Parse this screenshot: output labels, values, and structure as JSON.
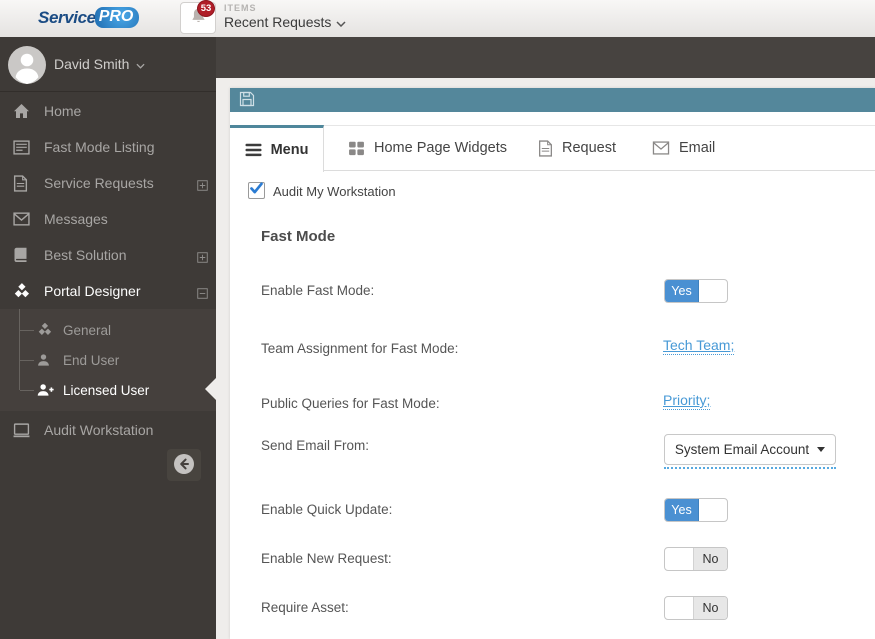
{
  "topbar": {
    "logo": {
      "brand_service": "Service",
      "brand_pro": "PRO"
    },
    "notification_badge": "53",
    "items_label": "ITEMS",
    "recent_dropdown": "Recent Requests"
  },
  "sidebar": {
    "user_name": "David Smith",
    "items": [
      {
        "label": "Home"
      },
      {
        "label": "Fast Mode Listing"
      },
      {
        "label": "Service Requests",
        "expandable": "collapsed"
      },
      {
        "label": "Messages"
      },
      {
        "label": "Best Solution",
        "expandable": "collapsed"
      },
      {
        "label": "Portal Designer",
        "expandable": "expanded",
        "active": true
      }
    ],
    "portal_designer_children": [
      {
        "label": "General"
      },
      {
        "label": "End User"
      },
      {
        "label": "Licensed User",
        "active": true
      }
    ],
    "audit_item": {
      "label": "Audit Workstation"
    }
  },
  "panel": {
    "tabs": [
      {
        "label": "Menu",
        "active": true
      },
      {
        "label": "Home Page Widgets"
      },
      {
        "label": "Request"
      },
      {
        "label": "Email"
      }
    ],
    "audit_checkbox_label": "Audit My Workstation",
    "audit_checkbox_checked": true,
    "section_title": "Fast Mode",
    "settings": [
      {
        "label": "Enable Fast Mode:",
        "type": "toggle",
        "value": "Yes"
      },
      {
        "label": "Team Assignment for Fast Mode:",
        "type": "link",
        "value": "Tech Team;"
      },
      {
        "label": "Public Queries for Fast Mode:",
        "type": "link",
        "value": "Priority;"
      },
      {
        "label": "Send Email From:",
        "type": "dropdown",
        "value": "System Email Account"
      },
      {
        "label": "Enable Quick Update:",
        "type": "toggle",
        "value": "Yes"
      },
      {
        "label": "Enable New Request:",
        "type": "toggle",
        "value": "No"
      },
      {
        "label": "Require Asset:",
        "type": "toggle",
        "value": "No"
      }
    ]
  },
  "colors": {
    "teal_header": "#54879b",
    "toggle_active_blue": "#4a90d2",
    "link_blue": "#4799d6",
    "sidebar_bg": "#3e3a37",
    "top_band": "#474340",
    "badge_red": "#b01e28"
  }
}
